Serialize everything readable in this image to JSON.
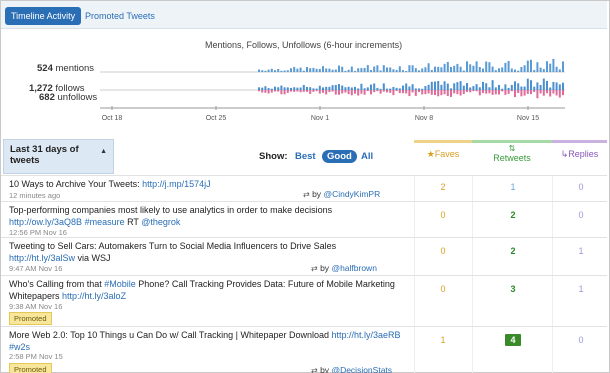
{
  "tabs": {
    "active": "Timeline Activity",
    "other": "Promoted Tweets"
  },
  "chart": {
    "title": "Mentions, Follows, Unfollows (6-hour increments)",
    "mentions_count": "524",
    "mentions_label": "mentions",
    "follows_count": "1,272",
    "follows_label": "follows",
    "unfollows_count": "682",
    "unfollows_label": "unfollows",
    "dates": [
      "Oct 18",
      "Oct 25",
      "Nov 1",
      "Nov 8",
      "Nov 15"
    ],
    "colors": {
      "mentions": "#5b9bd5",
      "follows": "#4a8fd0",
      "unfollows": "#e06a9a"
    }
  },
  "controls": {
    "period": "Last 31 days of tweets",
    "show_label": "Show:",
    "show_options": [
      "Best",
      "Good",
      "All"
    ],
    "show_selected": "Good"
  },
  "columns": {
    "faves": "Faves",
    "retweets": "Retweets",
    "replies": "Replies"
  },
  "rows": [
    {
      "text": "10 Ways to Archive Your Tweets: ",
      "link": "http://j.mp/1574jJ",
      "time": "12 minutes ago",
      "by": "by",
      "user": "@CindyKimPR",
      "faves": "2",
      "rts": "1",
      "replies": "0"
    },
    {
      "text": "Top-performing companies most likely to use analytics in order to make decisions ",
      "link": "http://ow.ly/3aQ8B",
      "link2": "#measure",
      "mid": " RT ",
      "user_inline": "@thegrok",
      "time": "12:56 PM Nov 16",
      "faves": "0",
      "rts": "2",
      "replies": "0"
    },
    {
      "text": "Tweeting to Sell Cars: Automakers Turn to Social Media Influencers to Drive Sales ",
      "link": "http://ht.ly/3alSw",
      "tail": " via WSJ",
      "time": "9:47 AM Nov 16",
      "by": "by",
      "user": "@halfbrown",
      "faves": "0",
      "rts": "2",
      "replies": "1"
    },
    {
      "text": "Who's Calling from that ",
      "tag": "#Mobile",
      "text2": " Phone? Call Tracking Provides Data: Future of Mobile Marketing Whitepapers ",
      "link": "http://ht.ly/3aloZ",
      "time": "9:38 AM Nov 16",
      "badge": "Promoted",
      "faves": "0",
      "rts": "3",
      "replies": "1"
    },
    {
      "text": "More Web 2.0: Top 10 Things u Can Do w/ Call Tracking | Whitepaper Download ",
      "link": "http://ht.ly/3aeRB",
      "tag": "#w2s",
      "time": "2:58 PM Nov 15",
      "badge": "Promoted",
      "by": "by",
      "user": "@DecisionStats",
      "faves": "1",
      "rts": "4",
      "replies": "0"
    }
  ]
}
